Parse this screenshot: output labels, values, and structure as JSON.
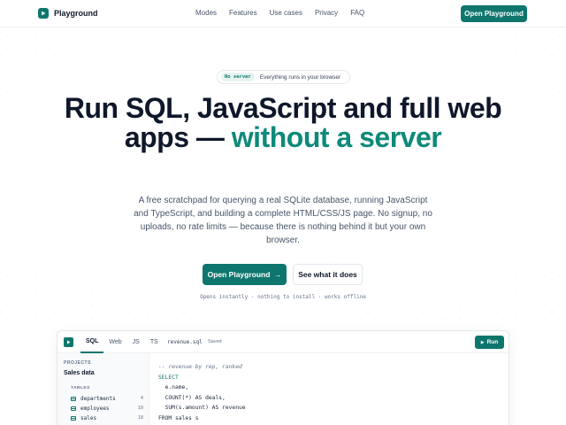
{
  "nav": {
    "brand": "Playground",
    "links": [
      "Modes",
      "Features",
      "Use cases",
      "Privacy",
      "FAQ"
    ],
    "cta": "Open Playground"
  },
  "hero": {
    "pill_tag": "No server",
    "pill_text": "Everything runs in your browser",
    "headline_part1": "Run SQL, JavaScript and full web apps — ",
    "headline_accent": "without a server",
    "subtext": "A free scratchpad for querying a real SQLite database, running JavaScript and TypeScript, and building a complete HTML/CSS/JS page. No signup, no uploads, no rate limits — because there is nothing behind it but your own browser.",
    "primary_button": "Open Playground",
    "secondary_button": "See what it does",
    "microcopy": "Opens instantly · nothing to install · works offline"
  },
  "app": {
    "tabs": [
      "SQL",
      "Web",
      "JS",
      "TS"
    ],
    "active_tab": "SQL",
    "file_name": "revenue.sql",
    "file_status": "Saved",
    "run_label": "Run",
    "sidebar": {
      "projects_heading": "PROJECTS",
      "project_name": "Sales data",
      "tables_heading": "TABLES",
      "tables": [
        {
          "name": "departments",
          "count": "4"
        },
        {
          "name": "employees",
          "count": "10"
        },
        {
          "name": "sales",
          "count": "18"
        }
      ]
    },
    "code": [
      "-- revenue by rep, ranked",
      "SELECT",
      "  e.name,",
      "  COUNT(*) AS deals,",
      "  SUM(s.amount) AS revenue",
      "FROM sales s"
    ]
  },
  "colors": {
    "brand": "#0f766e",
    "accent_text": "#0f8a7a",
    "text": "#0f172a",
    "muted": "#475569"
  }
}
